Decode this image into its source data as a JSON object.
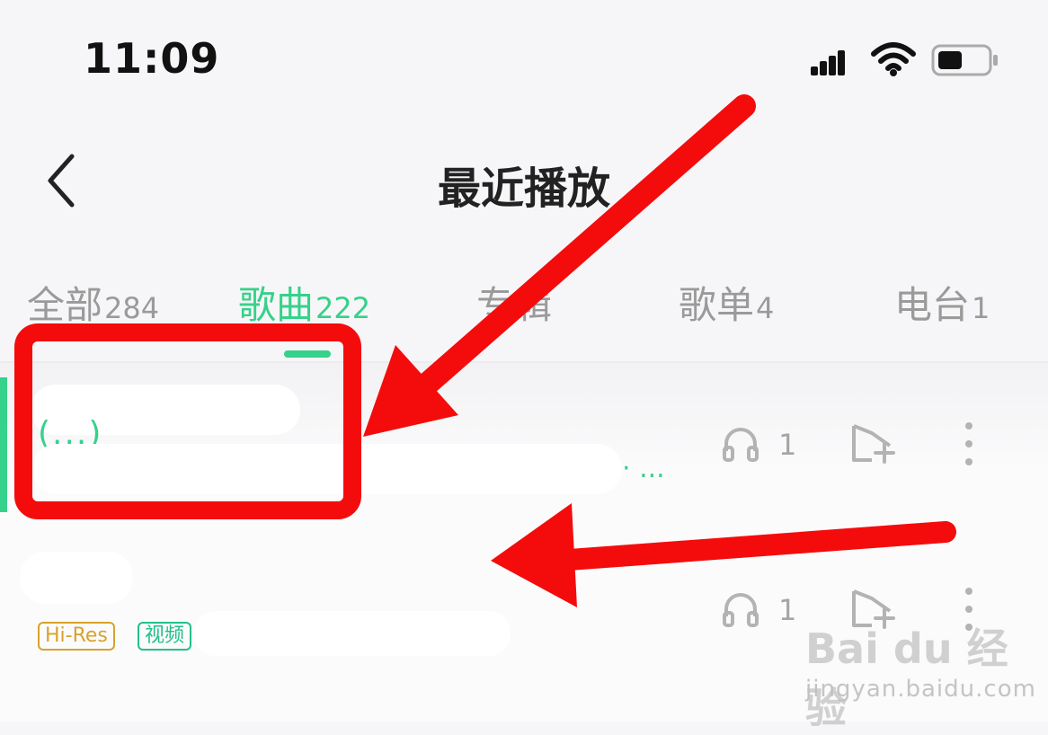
{
  "status_bar": {
    "time": "11:09"
  },
  "header": {
    "title": "最近播放"
  },
  "tabs": [
    {
      "label": "全部",
      "count": "284"
    },
    {
      "label": "歌曲",
      "count": "222"
    },
    {
      "label": "专辑",
      "count": ""
    },
    {
      "label": "歌单",
      "count": "4"
    },
    {
      "label": "电台",
      "count": "1"
    }
  ],
  "songs": [
    {
      "title": "(...)",
      "plays": "1",
      "subinfo_more": "· ..."
    },
    {
      "title": "",
      "plays": "1",
      "badges": [
        "Hi-Res",
        "视频"
      ]
    }
  ],
  "watermark": {
    "logo": "Bai du 经验",
    "url": "jingyan.baidu.com"
  },
  "colors": {
    "accent": "#36d18a",
    "annotation": "#f40c0c",
    "hires_badge": "#d9a22c"
  }
}
